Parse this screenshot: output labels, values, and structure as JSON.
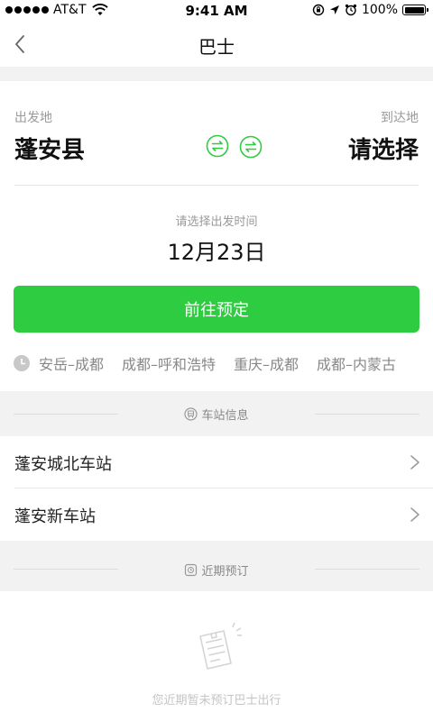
{
  "status_bar": {
    "carrier": "AT&T",
    "time": "9:41 AM",
    "battery": "100%"
  },
  "nav": {
    "title": "巴士"
  },
  "route": {
    "from_label": "出发地",
    "from_city": "蓬安县",
    "to_label": "到达地",
    "to_city": "请选择"
  },
  "date": {
    "label": "请选择出发时间",
    "value": "12月23日"
  },
  "book_button": "前往预定",
  "history": [
    "安岳–成都",
    "成都–呼和浩特",
    "重庆–成都",
    "成都–内蒙古"
  ],
  "station_section": {
    "title": "车站信息",
    "stations": [
      "蓬安城北车站",
      "蓬安新车站"
    ]
  },
  "recent_section": {
    "title": "近期预订",
    "empty_text": "您近期暂未预订巴士出行"
  },
  "colors": {
    "accent": "#2ecc40",
    "band": "#f2f2f2"
  }
}
